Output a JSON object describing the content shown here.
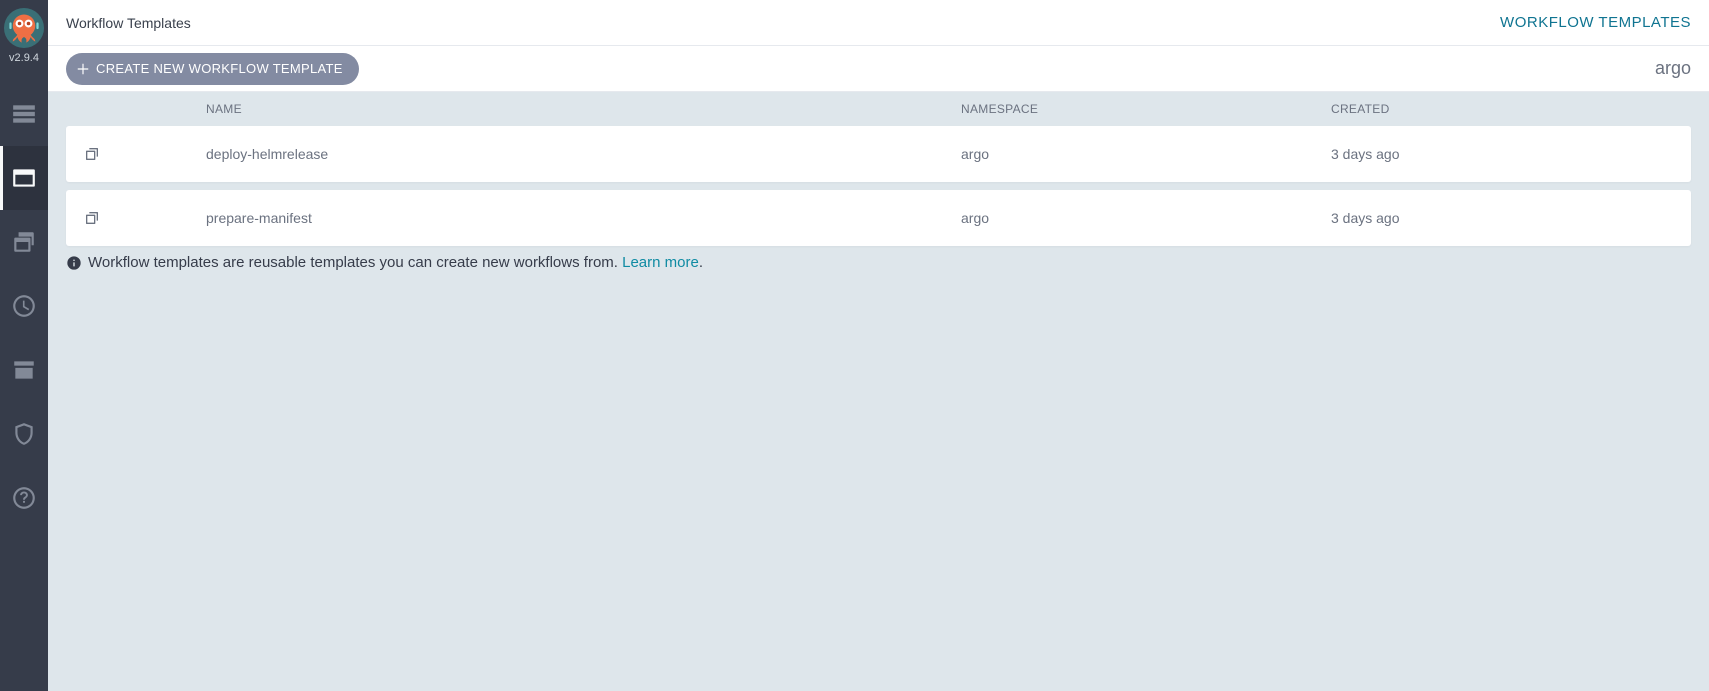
{
  "version": "v2.9.4",
  "breadcrumb": "Workflow Templates",
  "top_right_label": "WORKFLOW TEMPLATES",
  "toolbar": {
    "create_label": "CREATE NEW WORKFLOW TEMPLATE",
    "namespace": "argo"
  },
  "table": {
    "headers": {
      "name": "NAME",
      "namespace": "NAMESPACE",
      "created": "CREATED"
    },
    "rows": [
      {
        "name": "deploy-helmrelease",
        "namespace": "argo",
        "created": "3 days ago"
      },
      {
        "name": "prepare-manifest",
        "namespace": "argo",
        "created": "3 days ago"
      }
    ]
  },
  "info": {
    "text": "Workflow templates are reusable templates you can create new workflows from. ",
    "link_label": "Learn more",
    "suffix": "."
  }
}
